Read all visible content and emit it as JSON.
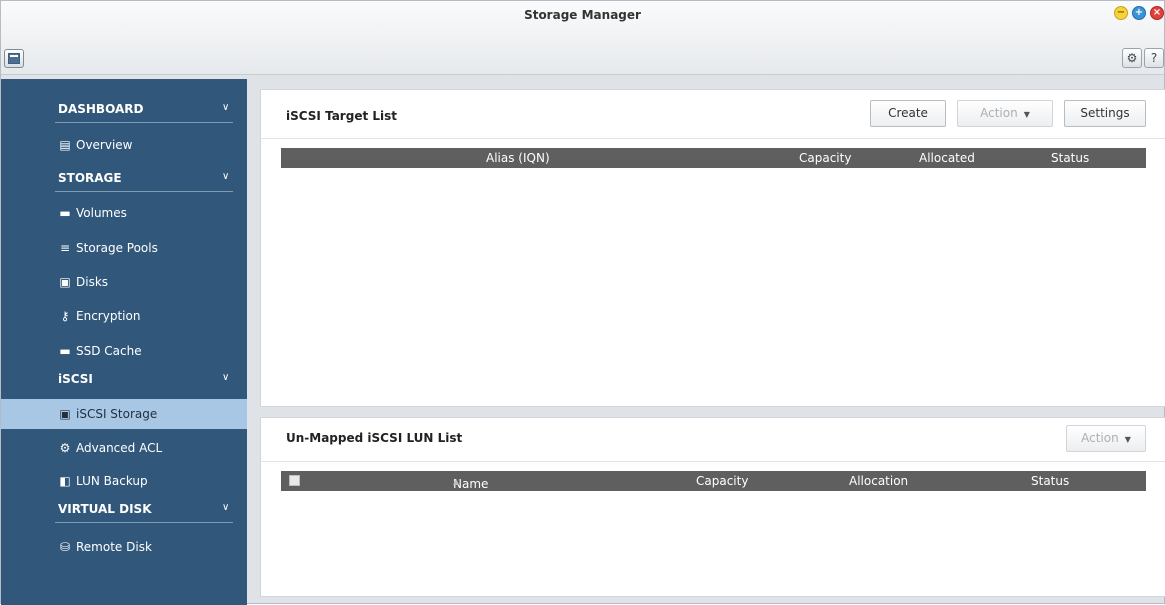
{
  "window": {
    "title": "Storage Manager",
    "buttons": {
      "minimize": "−",
      "maximize": "+",
      "close": "×"
    },
    "toolbar": {
      "settings_icon": "gear-icon",
      "help_label": "?"
    }
  },
  "sidebar": {
    "sections": [
      {
        "label": "DASHBOARD",
        "items": [
          {
            "label": "Overview",
            "icon": "overview-icon"
          }
        ]
      },
      {
        "label": "STORAGE",
        "items": [
          {
            "label": "Volumes",
            "icon": "volume-icon"
          },
          {
            "label": "Storage Pools",
            "icon": "storage-pools-icon"
          },
          {
            "label": "Disks",
            "icon": "disk-icon"
          },
          {
            "label": "Encryption",
            "icon": "key-icon"
          },
          {
            "label": "SSD Cache",
            "icon": "ssd-cache-icon"
          }
        ]
      },
      {
        "label": "iSCSI",
        "items": [
          {
            "label": "iSCSI Storage",
            "icon": "iscsi-storage-icon",
            "active": true
          },
          {
            "label": "Advanced ACL",
            "icon": "gear-icon"
          },
          {
            "label": "LUN Backup",
            "icon": "lun-backup-icon"
          }
        ]
      },
      {
        "label": "VIRTUAL DISK",
        "items": [
          {
            "label": "Remote Disk",
            "icon": "remote-disk-icon"
          }
        ]
      }
    ]
  },
  "target_list": {
    "title": "iSCSI Target List",
    "buttons": {
      "create": "Create",
      "action": "Action",
      "settings": "Settings"
    },
    "columns": [
      "Alias (IQN)",
      "Capacity",
      "Allocated",
      "Status"
    ]
  },
  "lun_list": {
    "title": "Un-Mapped iSCSI LUN List",
    "buttons": {
      "action": "Action"
    },
    "columns": [
      "Name",
      "Capacity",
      "Allocation",
      "Status"
    ]
  },
  "colors": {
    "sidebar": "#31587b",
    "sidebar_active": "#a7c7e4",
    "table_header": "#5f5f5f"
  }
}
